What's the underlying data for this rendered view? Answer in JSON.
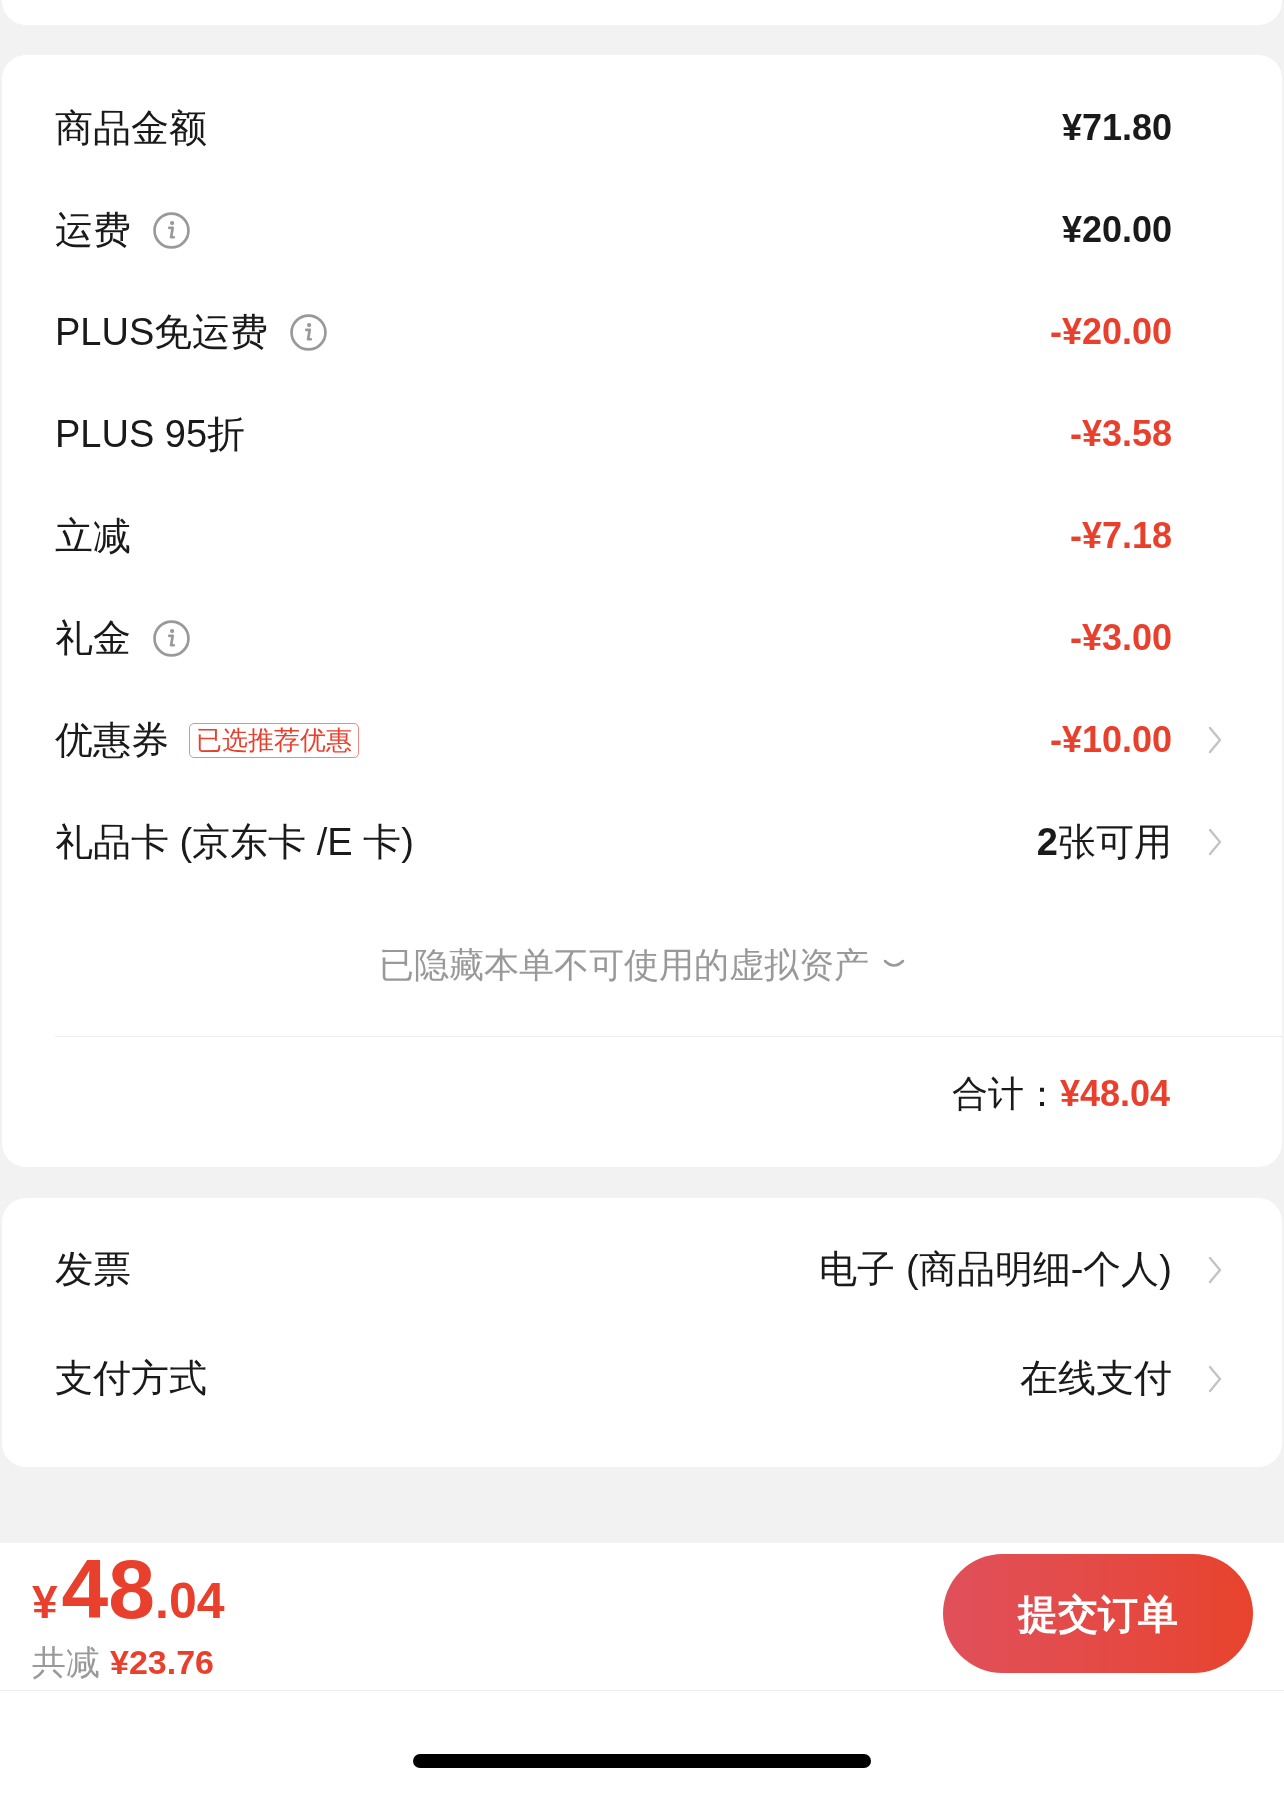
{
  "summary": {
    "rows": [
      {
        "label": "商品金额",
        "info": false,
        "value": "¥71.80",
        "kind": "amount",
        "link": false
      },
      {
        "label": "运费",
        "info": true,
        "value": "¥20.00",
        "kind": "amount",
        "link": false
      },
      {
        "label": "PLUS免运费",
        "info": true,
        "value": "-¥20.00",
        "kind": "deduction",
        "link": false
      },
      {
        "label": "PLUS 95折",
        "info": false,
        "value": "-¥3.58",
        "kind": "deduction",
        "link": false
      },
      {
        "label": "立减",
        "info": false,
        "value": "-¥7.18",
        "kind": "deduction",
        "link": false
      },
      {
        "label": "礼金",
        "info": true,
        "value": "-¥3.00",
        "kind": "deduction",
        "link": false
      },
      {
        "label": "优惠券",
        "info": false,
        "tag": "已选推荐优惠",
        "value": "-¥10.00",
        "kind": "deduction",
        "link": true
      },
      {
        "label": "礼品卡 (京东卡 /E 卡)",
        "info": false,
        "value": "**2**张可用",
        "kind": "text",
        "link": true
      }
    ],
    "hidden_note": {
      "text": "已隐藏本单不可使用的虚拟资产",
      "expanded": false
    },
    "total": {
      "label": "合计：",
      "value": "¥48.04"
    }
  },
  "options": {
    "rows": [
      {
        "label": "发票",
        "value": "电子 (商品明细-个人)",
        "kind": "text",
        "link": true
      },
      {
        "label": "支付方式",
        "value": "在线支付",
        "kind": "text",
        "link": true
      }
    ]
  },
  "bottom_bar": {
    "price": {
      "currency": "¥",
      "integer": "48",
      "decimal": ".04"
    },
    "savings": {
      "label": "共减",
      "value": "¥23.76"
    },
    "submit_button": "提交订单"
  }
}
